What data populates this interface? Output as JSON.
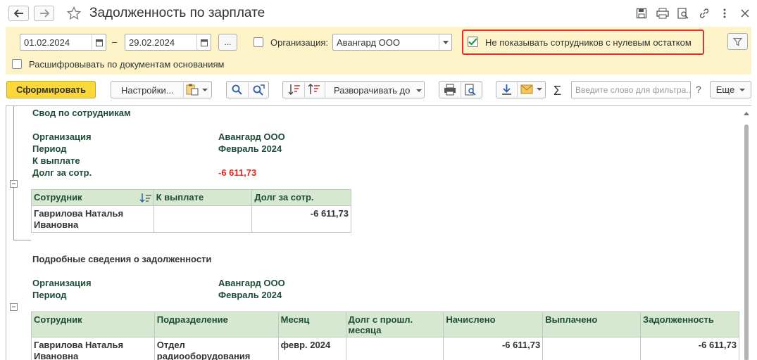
{
  "window": {
    "title": "Задолженность по зарплате",
    "icons": [
      "back-arrow-icon",
      "forward-arrow-icon",
      "star-icon",
      "save-icon",
      "print-icon",
      "preview-icon",
      "link-icon",
      "more-vert-icon",
      "close-icon"
    ]
  },
  "params": {
    "date_from": "01.02.2024",
    "date_to": "29.02.2024",
    "dash": "–",
    "more_button": "...",
    "org_label": "Организация:",
    "org_value": "Авангард ООО",
    "hide_zero_label": "Не показывать сотрудников с нулевым остатком",
    "decode_label": "Расшифровывать по документам основаниям"
  },
  "toolbar": {
    "generate": "Сформировать",
    "settings": "Настройки...",
    "expand_to": "Разворачивать до",
    "search_placeholder": "Введите слово для фильтра...",
    "help": "?",
    "more": "Еще",
    "sigma": "Σ"
  },
  "report": {
    "summary_title": "Свод по сотрудникам",
    "org_label": "Организация",
    "org_value": "Авангард ООО",
    "period_label": "Период",
    "period_value": "Февраль 2024",
    "to_pay_label": "К выплате",
    "debt_label": "Долг за сотр.",
    "debt_value": "-6 611,73",
    "summary_table": {
      "headers": [
        "Сотрудник",
        "К выплате",
        "Долг за сотр."
      ],
      "rows": [
        {
          "employee_line1": "Гаврилова Наталья",
          "employee_line2": "Ивановна",
          "to_pay": "",
          "debt": "-6 611,73"
        }
      ]
    },
    "details_title": "Подробные сведения о задолженности",
    "details_table": {
      "headers": [
        "Сотрудник",
        "Подразделение",
        "Месяц",
        "Долг с прошл.",
        "месяца",
        "Начислено",
        "Выплачено",
        "Задолженность"
      ],
      "rows": [
        {
          "employee_line1": "Гаврилова Наталья",
          "employee_line2": "Ивановна",
          "dept_line1": "Отдел",
          "dept_line2": "радиооборудования",
          "month": "февр. 2024",
          "prev_debt": "",
          "accrued": "-6 611,73",
          "paid": "",
          "debt": "-6 611,73"
        }
      ]
    }
  }
}
